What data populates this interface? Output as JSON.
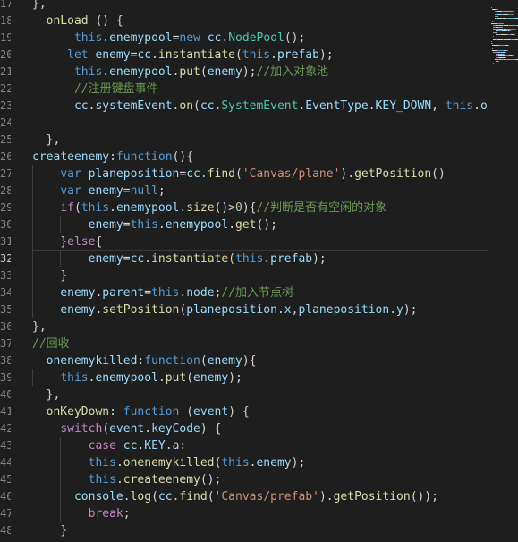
{
  "editor": {
    "line_numbers": [
      "17",
      "18",
      "19",
      "20",
      "21",
      "22",
      "23",
      "24",
      "25",
      "26",
      "27",
      "28",
      "29",
      "30",
      "31",
      "32",
      "33",
      "34",
      "35",
      "36",
      "37",
      "38",
      "39",
      "40",
      "41",
      "42",
      "43",
      "44",
      "45",
      "46",
      "47",
      "48"
    ],
    "active_line_index": 15,
    "lines": [
      {
        "indent": 0,
        "tokens": [
          {
            "t": "},",
            "c": "pun"
          }
        ]
      },
      {
        "indent": 2,
        "tokens": [
          {
            "t": "onLoad",
            "c": "fn"
          },
          {
            "t": " () {",
            "c": "pun"
          }
        ]
      },
      {
        "indent": 6,
        "tokens": [
          {
            "t": "this",
            "c": "this"
          },
          {
            "t": ".",
            "c": "pun"
          },
          {
            "t": "enemypool",
            "c": "prop"
          },
          {
            "t": "=",
            "c": "pun"
          },
          {
            "t": "new",
            "c": "kw"
          },
          {
            "t": " ",
            "c": "pun"
          },
          {
            "t": "cc",
            "c": "prop"
          },
          {
            "t": ".",
            "c": "pun"
          },
          {
            "t": "NodePool",
            "c": "cls"
          },
          {
            "t": "();",
            "c": "pun"
          }
        ]
      },
      {
        "indent": 5,
        "tokens": [
          {
            "t": "let",
            "c": "kw"
          },
          {
            "t": " ",
            "c": "pun"
          },
          {
            "t": "enemy",
            "c": "prop"
          },
          {
            "t": "=",
            "c": "pun"
          },
          {
            "t": "cc",
            "c": "prop"
          },
          {
            "t": ".",
            "c": "pun"
          },
          {
            "t": "instantiate",
            "c": "fn"
          },
          {
            "t": "(",
            "c": "pun"
          },
          {
            "t": "this",
            "c": "this"
          },
          {
            "t": ".",
            "c": "pun"
          },
          {
            "t": "prefab",
            "c": "prop"
          },
          {
            "t": ");",
            "c": "pun"
          }
        ]
      },
      {
        "indent": 6,
        "tokens": [
          {
            "t": "this",
            "c": "this"
          },
          {
            "t": ".",
            "c": "pun"
          },
          {
            "t": "enemypool",
            "c": "prop"
          },
          {
            "t": ".",
            "c": "pun"
          },
          {
            "t": "put",
            "c": "fn"
          },
          {
            "t": "(",
            "c": "pun"
          },
          {
            "t": "enemy",
            "c": "prop"
          },
          {
            "t": ");",
            "c": "pun"
          },
          {
            "t": "//加入对象池",
            "c": "cmt"
          }
        ]
      },
      {
        "indent": 6,
        "tokens": [
          {
            "t": "//注册键盘事件",
            "c": "cmt"
          }
        ]
      },
      {
        "indent": 6,
        "tokens": [
          {
            "t": "cc",
            "c": "prop"
          },
          {
            "t": ".",
            "c": "pun"
          },
          {
            "t": "systemEvent",
            "c": "prop"
          },
          {
            "t": ".",
            "c": "pun"
          },
          {
            "t": "on",
            "c": "fn"
          },
          {
            "t": "(",
            "c": "pun"
          },
          {
            "t": "cc",
            "c": "prop"
          },
          {
            "t": ".",
            "c": "pun"
          },
          {
            "t": "SystemEvent",
            "c": "cls"
          },
          {
            "t": ".",
            "c": "pun"
          },
          {
            "t": "EventType",
            "c": "prop"
          },
          {
            "t": ".",
            "c": "pun"
          },
          {
            "t": "KEY_DOWN",
            "c": "prop"
          },
          {
            "t": ", ",
            "c": "pun"
          },
          {
            "t": "this",
            "c": "this"
          },
          {
            "t": ".",
            "c": "pun"
          },
          {
            "t": "onK",
            "c": "prop"
          }
        ]
      },
      {
        "indent": 0,
        "tokens": []
      },
      {
        "indent": 2,
        "tokens": [
          {
            "t": "},",
            "c": "pun"
          }
        ]
      },
      {
        "indent": 0,
        "tokens": [
          {
            "t": "createenemy",
            "c": "prop"
          },
          {
            "t": ":",
            "c": "pun"
          },
          {
            "t": "function",
            "c": "kw"
          },
          {
            "t": "(){",
            "c": "pun"
          }
        ]
      },
      {
        "indent": 4,
        "tokens": [
          {
            "t": "var",
            "c": "kw"
          },
          {
            "t": " ",
            "c": "pun"
          },
          {
            "t": "planeposition",
            "c": "prop"
          },
          {
            "t": "=",
            "c": "pun"
          },
          {
            "t": "cc",
            "c": "prop"
          },
          {
            "t": ".",
            "c": "pun"
          },
          {
            "t": "find",
            "c": "fn"
          },
          {
            "t": "(",
            "c": "pun"
          },
          {
            "t": "'Canvas/plane'",
            "c": "str"
          },
          {
            "t": ").",
            "c": "pun"
          },
          {
            "t": "getPosition",
            "c": "fn"
          },
          {
            "t": "()",
            "c": "pun"
          }
        ]
      },
      {
        "indent": 4,
        "tokens": [
          {
            "t": "var",
            "c": "kw"
          },
          {
            "t": " ",
            "c": "pun"
          },
          {
            "t": "enemy",
            "c": "prop"
          },
          {
            "t": "=",
            "c": "pun"
          },
          {
            "t": "null",
            "c": "kw"
          },
          {
            "t": ";",
            "c": "pun"
          }
        ]
      },
      {
        "indent": 4,
        "tokens": [
          {
            "t": "if",
            "c": "ctl"
          },
          {
            "t": "(",
            "c": "pun"
          },
          {
            "t": "this",
            "c": "this"
          },
          {
            "t": ".",
            "c": "pun"
          },
          {
            "t": "enemypool",
            "c": "prop"
          },
          {
            "t": ".",
            "c": "pun"
          },
          {
            "t": "size",
            "c": "fn"
          },
          {
            "t": "()>",
            "c": "pun"
          },
          {
            "t": "0",
            "c": "num"
          },
          {
            "t": "){",
            "c": "pun"
          },
          {
            "t": "//判断是否有空闲的对象",
            "c": "cmt"
          }
        ]
      },
      {
        "indent": 8,
        "tokens": [
          {
            "t": "enemy",
            "c": "prop"
          },
          {
            "t": "=",
            "c": "pun"
          },
          {
            "t": "this",
            "c": "this"
          },
          {
            "t": ".",
            "c": "pun"
          },
          {
            "t": "enemypool",
            "c": "prop"
          },
          {
            "t": ".",
            "c": "pun"
          },
          {
            "t": "get",
            "c": "fn"
          },
          {
            "t": "();",
            "c": "pun"
          }
        ]
      },
      {
        "indent": 4,
        "tokens": [
          {
            "t": "}",
            "c": "pun"
          },
          {
            "t": "else",
            "c": "ctl"
          },
          {
            "t": "{",
            "c": "pun"
          }
        ]
      },
      {
        "indent": 8,
        "tokens": [
          {
            "t": "enemy",
            "c": "prop"
          },
          {
            "t": "=",
            "c": "pun"
          },
          {
            "t": "cc",
            "c": "prop"
          },
          {
            "t": ".",
            "c": "pun"
          },
          {
            "t": "instantiate",
            "c": "fn"
          },
          {
            "t": "(",
            "c": "pun"
          },
          {
            "t": "this",
            "c": "this"
          },
          {
            "t": ".",
            "c": "pun"
          },
          {
            "t": "prefab",
            "c": "prop"
          },
          {
            "t": ");",
            "c": "pun"
          }
        ],
        "cursor": true
      },
      {
        "indent": 4,
        "tokens": [
          {
            "t": "}",
            "c": "pun"
          }
        ]
      },
      {
        "indent": 4,
        "tokens": [
          {
            "t": "enemy",
            "c": "prop"
          },
          {
            "t": ".",
            "c": "pun"
          },
          {
            "t": "parent",
            "c": "prop"
          },
          {
            "t": "=",
            "c": "pun"
          },
          {
            "t": "this",
            "c": "this"
          },
          {
            "t": ".",
            "c": "pun"
          },
          {
            "t": "node",
            "c": "prop"
          },
          {
            "t": ";",
            "c": "pun"
          },
          {
            "t": "//加入节点树",
            "c": "cmt"
          }
        ]
      },
      {
        "indent": 4,
        "tokens": [
          {
            "t": "enemy",
            "c": "prop"
          },
          {
            "t": ".",
            "c": "pun"
          },
          {
            "t": "setPosition",
            "c": "fn"
          },
          {
            "t": "(",
            "c": "pun"
          },
          {
            "t": "planeposition",
            "c": "prop"
          },
          {
            "t": ".",
            "c": "pun"
          },
          {
            "t": "x",
            "c": "prop"
          },
          {
            "t": ",",
            "c": "pun"
          },
          {
            "t": "planeposition",
            "c": "prop"
          },
          {
            "t": ".",
            "c": "pun"
          },
          {
            "t": "y",
            "c": "prop"
          },
          {
            "t": ");",
            "c": "pun"
          }
        ]
      },
      {
        "indent": 0,
        "tokens": [
          {
            "t": "},",
            "c": "pun"
          }
        ]
      },
      {
        "indent": 0,
        "tokens": [
          {
            "t": "//回收",
            "c": "cmt"
          }
        ]
      },
      {
        "indent": 2,
        "tokens": [
          {
            "t": "onenemykilled",
            "c": "prop"
          },
          {
            "t": ":",
            "c": "pun"
          },
          {
            "t": "function",
            "c": "kw"
          },
          {
            "t": "(",
            "c": "pun"
          },
          {
            "t": "enemy",
            "c": "prop"
          },
          {
            "t": "){",
            "c": "pun"
          }
        ]
      },
      {
        "indent": 4,
        "tokens": [
          {
            "t": "this",
            "c": "this"
          },
          {
            "t": ".",
            "c": "pun"
          },
          {
            "t": "enemypool",
            "c": "prop"
          },
          {
            "t": ".",
            "c": "pun"
          },
          {
            "t": "put",
            "c": "fn"
          },
          {
            "t": "(",
            "c": "pun"
          },
          {
            "t": "enemy",
            "c": "prop"
          },
          {
            "t": ");",
            "c": "pun"
          }
        ]
      },
      {
        "indent": 2,
        "tokens": [
          {
            "t": "},",
            "c": "pun"
          }
        ]
      },
      {
        "indent": 2,
        "tokens": [
          {
            "t": "onKeyDown",
            "c": "fn"
          },
          {
            "t": ": ",
            "c": "pun"
          },
          {
            "t": "function",
            "c": "kw"
          },
          {
            "t": " (",
            "c": "pun"
          },
          {
            "t": "event",
            "c": "prop"
          },
          {
            "t": ") {",
            "c": "pun"
          }
        ]
      },
      {
        "indent": 4,
        "tokens": [
          {
            "t": "switch",
            "c": "ctl"
          },
          {
            "t": "(",
            "c": "pun"
          },
          {
            "t": "event",
            "c": "prop"
          },
          {
            "t": ".",
            "c": "pun"
          },
          {
            "t": "keyCode",
            "c": "prop"
          },
          {
            "t": ") {",
            "c": "pun"
          }
        ]
      },
      {
        "indent": 8,
        "tokens": [
          {
            "t": "case",
            "c": "ctl"
          },
          {
            "t": " ",
            "c": "pun"
          },
          {
            "t": "cc",
            "c": "prop"
          },
          {
            "t": ".",
            "c": "pun"
          },
          {
            "t": "KEY",
            "c": "prop"
          },
          {
            "t": ".",
            "c": "pun"
          },
          {
            "t": "a",
            "c": "prop"
          },
          {
            "t": ":",
            "c": "pun"
          }
        ]
      },
      {
        "indent": 8,
        "tokens": [
          {
            "t": "this",
            "c": "this"
          },
          {
            "t": ".",
            "c": "pun"
          },
          {
            "t": "onenemykilled",
            "c": "fn"
          },
          {
            "t": "(",
            "c": "pun"
          },
          {
            "t": "this",
            "c": "this"
          },
          {
            "t": ".",
            "c": "pun"
          },
          {
            "t": "enemy",
            "c": "prop"
          },
          {
            "t": ");",
            "c": "pun"
          }
        ]
      },
      {
        "indent": 8,
        "tokens": [
          {
            "t": "this",
            "c": "this"
          },
          {
            "t": ".",
            "c": "pun"
          },
          {
            "t": "createenemy",
            "c": "fn"
          },
          {
            "t": "();",
            "c": "pun"
          }
        ]
      },
      {
        "indent": 6,
        "tokens": [
          {
            "t": "console",
            "c": "prop"
          },
          {
            "t": ".",
            "c": "pun"
          },
          {
            "t": "log",
            "c": "fn"
          },
          {
            "t": "(",
            "c": "pun"
          },
          {
            "t": "cc",
            "c": "prop"
          },
          {
            "t": ".",
            "c": "pun"
          },
          {
            "t": "find",
            "c": "fn"
          },
          {
            "t": "(",
            "c": "pun"
          },
          {
            "t": "'Canvas/prefab'",
            "c": "str"
          },
          {
            "t": ").",
            "c": "pun"
          },
          {
            "t": "getPosition",
            "c": "fn"
          },
          {
            "t": "());",
            "c": "pun"
          }
        ]
      },
      {
        "indent": 8,
        "tokens": [
          {
            "t": "break",
            "c": "ctl"
          },
          {
            "t": ";",
            "c": "pun"
          }
        ]
      },
      {
        "indent": 4,
        "tokens": [
          {
            "t": "}",
            "c": "pun"
          }
        ]
      }
    ]
  },
  "colors": {
    "background": "#1e1e1e",
    "keyword": "#569cd6",
    "function": "#dcdcaa",
    "property": "#9cdcfe",
    "class": "#4ec9b0",
    "string": "#ce9178",
    "number": "#b5cea8",
    "comment": "#6a9955",
    "control": "#c586c0"
  }
}
